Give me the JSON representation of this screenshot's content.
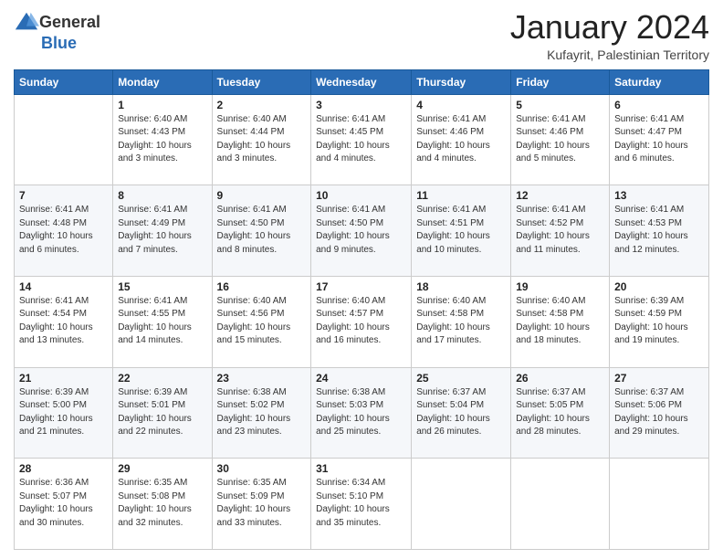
{
  "logo": {
    "general": "General",
    "blue": "Blue"
  },
  "title": {
    "main": "January 2024",
    "sub": "Kufayrit, Palestinian Territory"
  },
  "calendar": {
    "headers": [
      "Sunday",
      "Monday",
      "Tuesday",
      "Wednesday",
      "Thursday",
      "Friday",
      "Saturday"
    ],
    "rows": [
      [
        {
          "day": "",
          "info": ""
        },
        {
          "day": "1",
          "info": "Sunrise: 6:40 AM\nSunset: 4:43 PM\nDaylight: 10 hours\nand 3 minutes."
        },
        {
          "day": "2",
          "info": "Sunrise: 6:40 AM\nSunset: 4:44 PM\nDaylight: 10 hours\nand 3 minutes."
        },
        {
          "day": "3",
          "info": "Sunrise: 6:41 AM\nSunset: 4:45 PM\nDaylight: 10 hours\nand 4 minutes."
        },
        {
          "day": "4",
          "info": "Sunrise: 6:41 AM\nSunset: 4:46 PM\nDaylight: 10 hours\nand 4 minutes."
        },
        {
          "day": "5",
          "info": "Sunrise: 6:41 AM\nSunset: 4:46 PM\nDaylight: 10 hours\nand 5 minutes."
        },
        {
          "day": "6",
          "info": "Sunrise: 6:41 AM\nSunset: 4:47 PM\nDaylight: 10 hours\nand 6 minutes."
        }
      ],
      [
        {
          "day": "7",
          "info": "Sunrise: 6:41 AM\nSunset: 4:48 PM\nDaylight: 10 hours\nand 6 minutes."
        },
        {
          "day": "8",
          "info": "Sunrise: 6:41 AM\nSunset: 4:49 PM\nDaylight: 10 hours\nand 7 minutes."
        },
        {
          "day": "9",
          "info": "Sunrise: 6:41 AM\nSunset: 4:50 PM\nDaylight: 10 hours\nand 8 minutes."
        },
        {
          "day": "10",
          "info": "Sunrise: 6:41 AM\nSunset: 4:50 PM\nDaylight: 10 hours\nand 9 minutes."
        },
        {
          "day": "11",
          "info": "Sunrise: 6:41 AM\nSunset: 4:51 PM\nDaylight: 10 hours\nand 10 minutes."
        },
        {
          "day": "12",
          "info": "Sunrise: 6:41 AM\nSunset: 4:52 PM\nDaylight: 10 hours\nand 11 minutes."
        },
        {
          "day": "13",
          "info": "Sunrise: 6:41 AM\nSunset: 4:53 PM\nDaylight: 10 hours\nand 12 minutes."
        }
      ],
      [
        {
          "day": "14",
          "info": "Sunrise: 6:41 AM\nSunset: 4:54 PM\nDaylight: 10 hours\nand 13 minutes."
        },
        {
          "day": "15",
          "info": "Sunrise: 6:41 AM\nSunset: 4:55 PM\nDaylight: 10 hours\nand 14 minutes."
        },
        {
          "day": "16",
          "info": "Sunrise: 6:40 AM\nSunset: 4:56 PM\nDaylight: 10 hours\nand 15 minutes."
        },
        {
          "day": "17",
          "info": "Sunrise: 6:40 AM\nSunset: 4:57 PM\nDaylight: 10 hours\nand 16 minutes."
        },
        {
          "day": "18",
          "info": "Sunrise: 6:40 AM\nSunset: 4:58 PM\nDaylight: 10 hours\nand 17 minutes."
        },
        {
          "day": "19",
          "info": "Sunrise: 6:40 AM\nSunset: 4:58 PM\nDaylight: 10 hours\nand 18 minutes."
        },
        {
          "day": "20",
          "info": "Sunrise: 6:39 AM\nSunset: 4:59 PM\nDaylight: 10 hours\nand 19 minutes."
        }
      ],
      [
        {
          "day": "21",
          "info": "Sunrise: 6:39 AM\nSunset: 5:00 PM\nDaylight: 10 hours\nand 21 minutes."
        },
        {
          "day": "22",
          "info": "Sunrise: 6:39 AM\nSunset: 5:01 PM\nDaylight: 10 hours\nand 22 minutes."
        },
        {
          "day": "23",
          "info": "Sunrise: 6:38 AM\nSunset: 5:02 PM\nDaylight: 10 hours\nand 23 minutes."
        },
        {
          "day": "24",
          "info": "Sunrise: 6:38 AM\nSunset: 5:03 PM\nDaylight: 10 hours\nand 25 minutes."
        },
        {
          "day": "25",
          "info": "Sunrise: 6:37 AM\nSunset: 5:04 PM\nDaylight: 10 hours\nand 26 minutes."
        },
        {
          "day": "26",
          "info": "Sunrise: 6:37 AM\nSunset: 5:05 PM\nDaylight: 10 hours\nand 28 minutes."
        },
        {
          "day": "27",
          "info": "Sunrise: 6:37 AM\nSunset: 5:06 PM\nDaylight: 10 hours\nand 29 minutes."
        }
      ],
      [
        {
          "day": "28",
          "info": "Sunrise: 6:36 AM\nSunset: 5:07 PM\nDaylight: 10 hours\nand 30 minutes."
        },
        {
          "day": "29",
          "info": "Sunrise: 6:35 AM\nSunset: 5:08 PM\nDaylight: 10 hours\nand 32 minutes."
        },
        {
          "day": "30",
          "info": "Sunrise: 6:35 AM\nSunset: 5:09 PM\nDaylight: 10 hours\nand 33 minutes."
        },
        {
          "day": "31",
          "info": "Sunrise: 6:34 AM\nSunset: 5:10 PM\nDaylight: 10 hours\nand 35 minutes."
        },
        {
          "day": "",
          "info": ""
        },
        {
          "day": "",
          "info": ""
        },
        {
          "day": "",
          "info": ""
        }
      ]
    ]
  }
}
